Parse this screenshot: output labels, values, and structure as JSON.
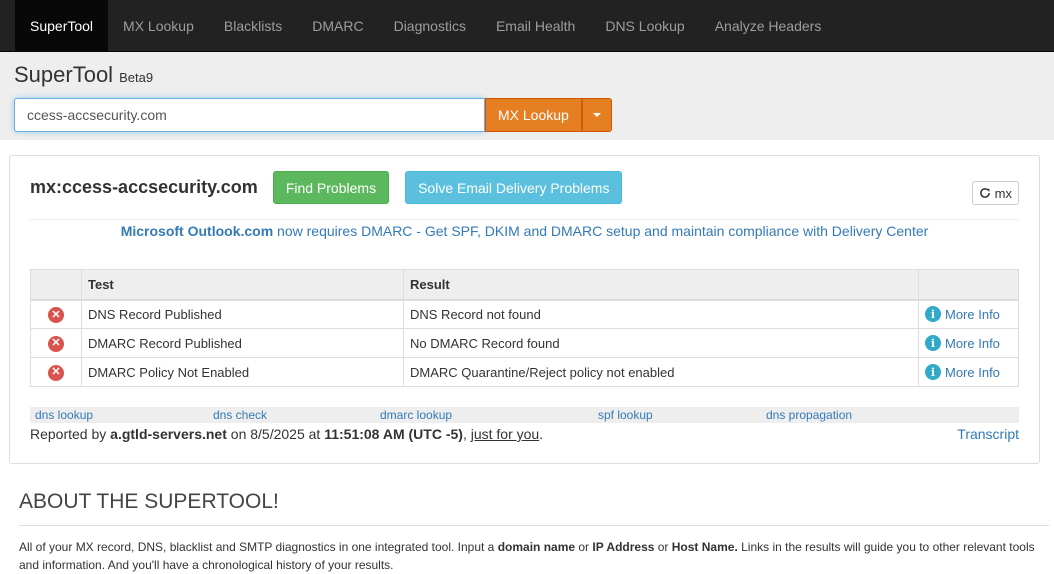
{
  "nav": {
    "items": [
      {
        "label": "SuperTool",
        "active": true
      },
      {
        "label": "MX Lookup"
      },
      {
        "label": "Blacklists"
      },
      {
        "label": "DMARC"
      },
      {
        "label": "Diagnostics"
      },
      {
        "label": "Email Health"
      },
      {
        "label": "DNS Lookup"
      },
      {
        "label": "Analyze Headers"
      }
    ]
  },
  "header": {
    "title": "SuperTool",
    "beta": "Beta9",
    "search_value": "ccess-accsecurity.com",
    "lookup_button": "MX Lookup"
  },
  "result": {
    "title": "mx:ccess-accsecurity.com",
    "find_problems": "Find Problems",
    "solve": "Solve Email Delivery Problems",
    "refresh_label": "mx",
    "promo_bold": "Microsoft Outlook.com",
    "promo_rest": " now requires DMARC - Get SPF, DKIM and DMARC setup and maintain compliance with Delivery Center",
    "table": {
      "headers": [
        "",
        "Test",
        "Result",
        ""
      ],
      "rows": [
        {
          "test": "DNS Record Published",
          "result": "DNS Record not found",
          "more": "More Info"
        },
        {
          "test": "DMARC Record Published",
          "result": "No DMARC Record found",
          "more": "More Info"
        },
        {
          "test": "DMARC Policy Not Enabled",
          "result": "DMARC Quarantine/Reject policy not enabled",
          "more": "More Info"
        }
      ]
    },
    "quicklinks": [
      "dns lookup",
      "dns check",
      "dmarc lookup",
      "spf lookup",
      "dns propagation"
    ],
    "report": {
      "prefix": "Reported by ",
      "server": "a.gtld-servers.net",
      "on": " on 8/5/2025 at ",
      "time": "11:51:08 AM (UTC -5)",
      "comma": ", ",
      "link": "just for you",
      "period": ".",
      "transcript": "Transcript"
    }
  },
  "about": {
    "heading": "ABOUT THE SUPERTOOL!",
    "p1": "All of your MX record, DNS, blacklist and SMTP diagnostics in one integrated tool.  Input a ",
    "b1": "domain name",
    "p2": " or ",
    "b2": "IP Address",
    "p3": " or ",
    "b3": "Host Name.",
    "p4": " Links in the results will guide you to other relevant tools and information.  And you'll have a chronological history of your results."
  },
  "colors": {
    "nav_bg": "#222222",
    "accent_orange": "#e67e22",
    "success": "#5cb85c",
    "info": "#5bc0de",
    "danger": "#d9534f",
    "link": "#337ab7"
  }
}
